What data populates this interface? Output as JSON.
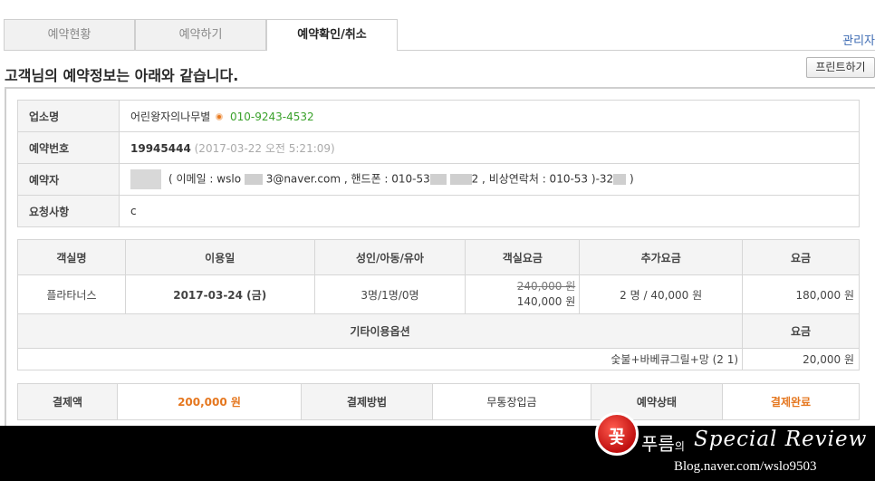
{
  "tabs": [
    {
      "label": "예약현황"
    },
    {
      "label": "예약하기"
    },
    {
      "label": "예약확인/취소"
    }
  ],
  "admin_link": "관리자",
  "heading": "고객님의 예약정보는 아래와 같습니다.",
  "print_button": "프린트하기",
  "info": {
    "business_label": "업소명",
    "business_name": "어린왕자의나무별",
    "business_phone": "010-9243-4532",
    "reservation_no_label": "예약번호",
    "reservation_no": "19945444",
    "reservation_time": "(2017-03-22 오전 5:21:09)",
    "booker_label": "예약자",
    "booker_email_prefix": "( 이메일 : wslo",
    "booker_email_suffix": "3@naver.com , 핸드폰 : 010-53",
    "booker_phone_tail": "2 , 비상연락처 : 010-53",
    "booker_emergency_tail": ")-32",
    "booker_close": ")",
    "request_label": "요청사항",
    "request_value": "c"
  },
  "room_table": {
    "headers": [
      "객실명",
      "이용일",
      "성인/아동/유아",
      "객실요금",
      "추가요금",
      "요금"
    ],
    "row": {
      "room_name": "플라타너스",
      "date": "2017-03-24 (금)",
      "guests": "3명/1명/0명",
      "original_price": "240,000 원",
      "room_price": "140,000 원",
      "extra": "2 명 / 40,000 원",
      "total": "180,000 원"
    },
    "option_header": "기타이용옵션",
    "option_fee_header": "요금",
    "option_item": "숯불+바베큐그릴+망 (2 1)",
    "option_fee": "20,000 원"
  },
  "payment": {
    "amount_label": "결제액",
    "amount": "200,000 원",
    "method_label": "결제방법",
    "method": "무통장입금",
    "status_label": "예약상태",
    "status": "결제완료"
  },
  "watermark": {
    "logo_char": "꽃",
    "brand": "푸름",
    "brand_suffix": "의",
    "title": "Special Review",
    "url": "Blog.naver.com/wslo9503"
  },
  "colors": {
    "accent_orange": "#e5771f",
    "phone_green": "#3aa12b",
    "link_blue": "#3d6bb3"
  }
}
